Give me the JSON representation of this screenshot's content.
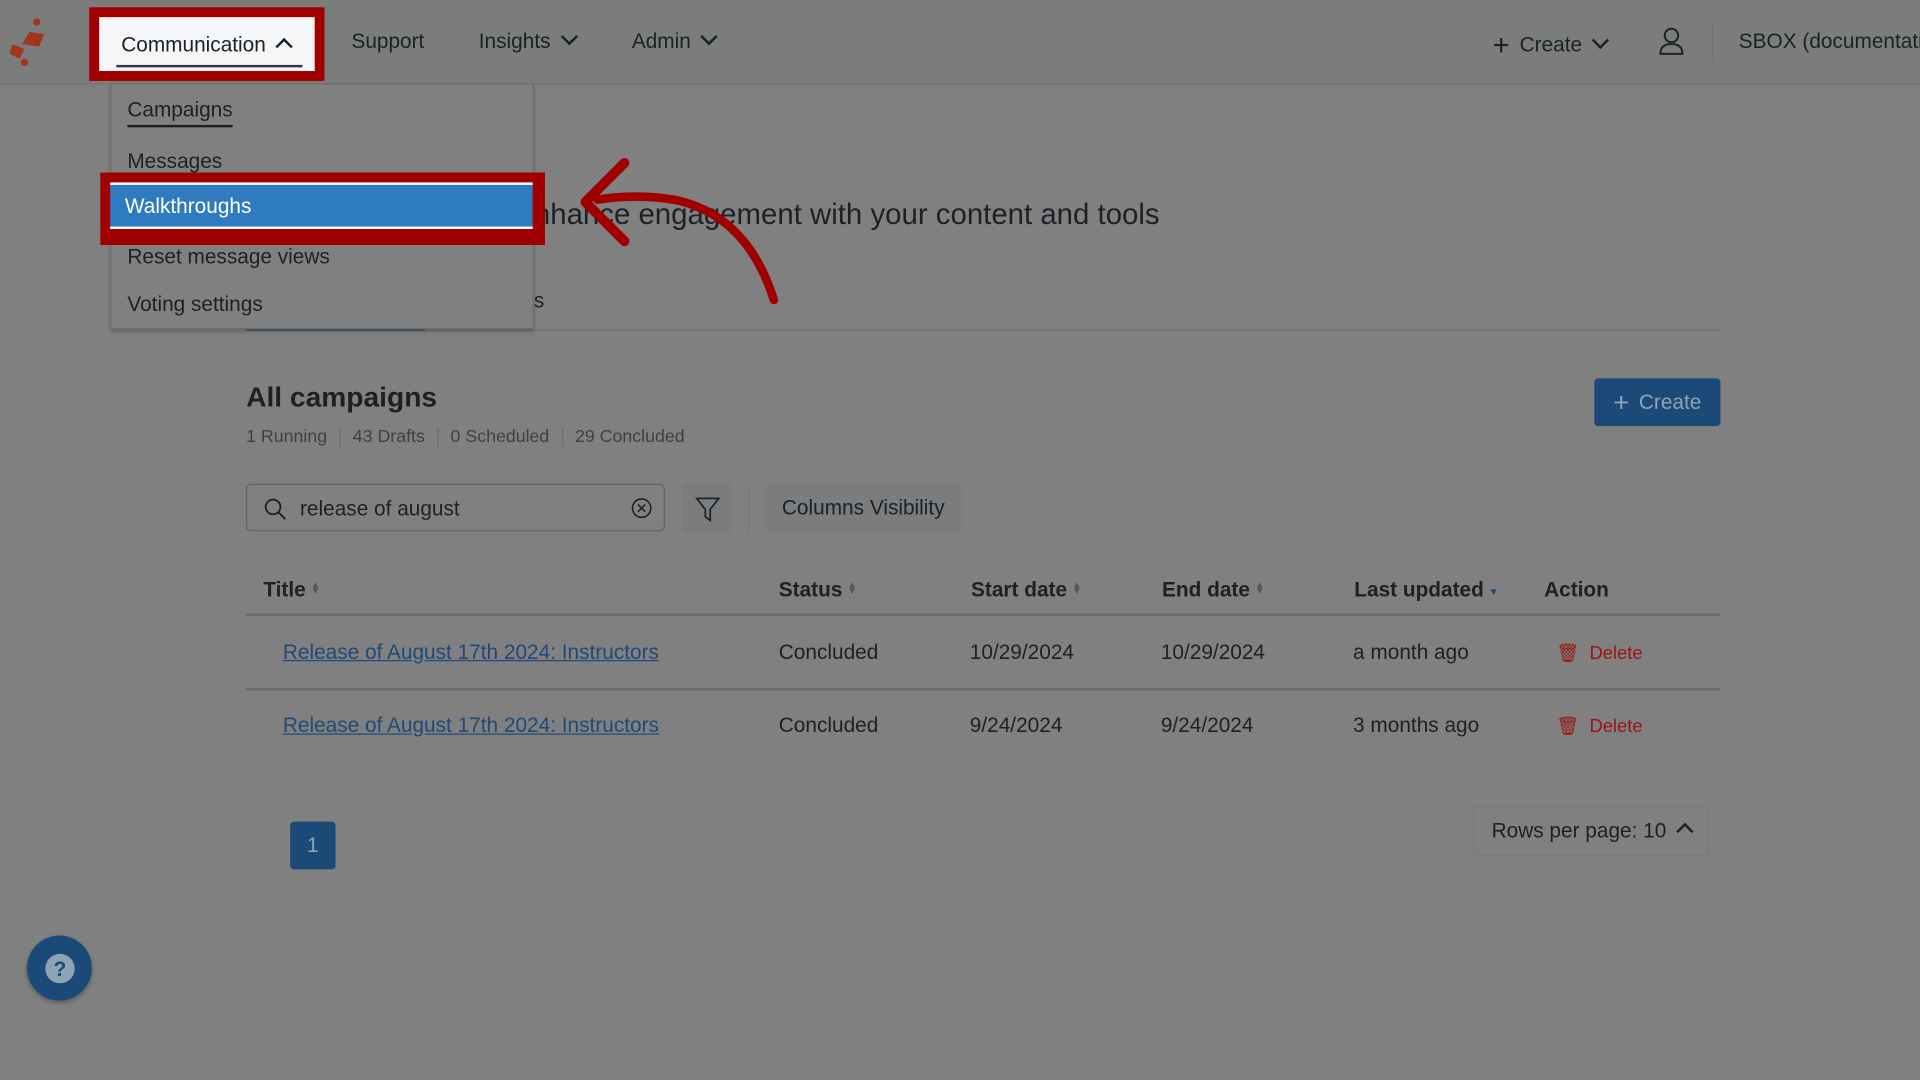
{
  "nav": {
    "items": [
      {
        "label": "Communication",
        "icon": "chevron-up-icon"
      },
      {
        "label": "Support"
      },
      {
        "label": "Insights",
        "icon": "chevron-down-icon"
      },
      {
        "label": "Admin",
        "icon": "chevron-down-icon"
      }
    ],
    "create_label": "Create",
    "account_label": "SBOX (documentati"
  },
  "menu": {
    "items": [
      "Campaigns",
      "Messages",
      "Walkthroughs",
      "Reset message views",
      "Voting settings"
    ],
    "highlighted": "Walkthroughs"
  },
  "page": {
    "subtitle_visible": "nhance engagement with your content and tools",
    "tab_fragment": "s",
    "section_title": "All campaigns",
    "stats": [
      "1 Running",
      "43 Drafts",
      "0 Scheduled",
      "29 Concluded"
    ],
    "create_button": "Create",
    "search_value": "release of august",
    "columns_visibility": "Columns Visibility"
  },
  "table": {
    "headers": [
      "Title",
      "Status",
      "Start date",
      "End date",
      "Last updated",
      "Action"
    ],
    "rows": [
      {
        "title": "Release of August 17th 2024: Instructors",
        "status": "Concluded",
        "start": "10/29/2024",
        "end": "10/29/2024",
        "updated": "a month ago",
        "action": "Delete"
      },
      {
        "title": "Release of August 17th 2024: Instructors",
        "status": "Concluded",
        "start": "9/24/2024",
        "end": "9/24/2024",
        "updated": "3 months ago",
        "action": "Delete"
      }
    ]
  },
  "pagination": {
    "current_page": "1",
    "rows_per_page": "Rows per page: 10"
  },
  "colors": {
    "highlight_outline": "#a00000",
    "menu_highlight": "#2f7bbf",
    "primary": "#1b4a78",
    "danger": "#9a1414"
  }
}
